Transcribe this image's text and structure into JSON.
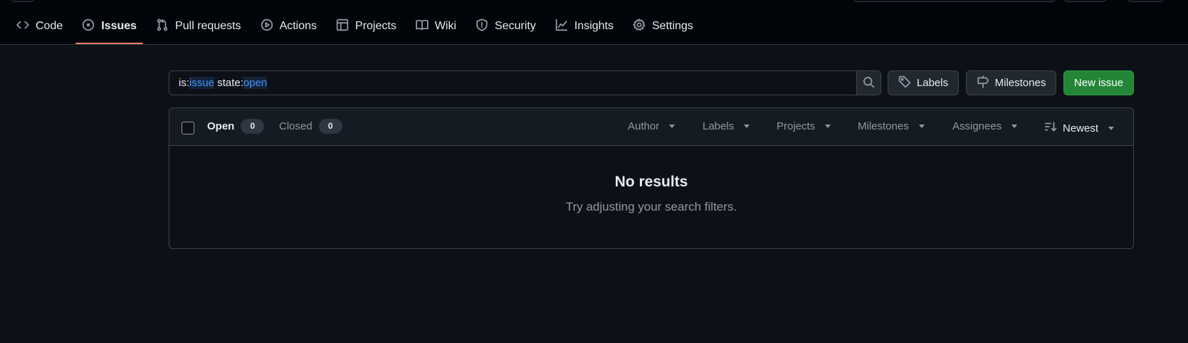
{
  "nav": {
    "tabs": [
      {
        "label": "Code",
        "icon": "code-icon"
      },
      {
        "label": "Issues",
        "icon": "issue-opened-icon",
        "selected": true
      },
      {
        "label": "Pull requests",
        "icon": "git-pull-request-icon"
      },
      {
        "label": "Actions",
        "icon": "play-icon"
      },
      {
        "label": "Projects",
        "icon": "table-icon"
      },
      {
        "label": "Wiki",
        "icon": "book-icon"
      },
      {
        "label": "Security",
        "icon": "shield-icon"
      },
      {
        "label": "Insights",
        "icon": "graph-icon"
      },
      {
        "label": "Settings",
        "icon": "gear-icon"
      }
    ]
  },
  "search": {
    "prefix": "is:",
    "term1": "issue",
    "middle": " state:",
    "term2": "open",
    "keyword_color": "#4493f8"
  },
  "toolbar": {
    "labels_label": "Labels",
    "milestones_label": "Milestones",
    "new_issue_label": "New issue"
  },
  "list_header": {
    "open_label": "Open",
    "open_count": "0",
    "closed_label": "Closed",
    "closed_count": "0",
    "filters": {
      "author": "Author",
      "labels": "Labels",
      "projects": "Projects",
      "milestones": "Milestones",
      "assignees": "Assignees",
      "sort": "Newest"
    }
  },
  "empty_state": {
    "title": "No results",
    "message": "Try adjusting your search filters."
  },
  "colors": {
    "accent_underline": "#f78166",
    "primary_button": "#238636",
    "background": "#0d1117"
  }
}
